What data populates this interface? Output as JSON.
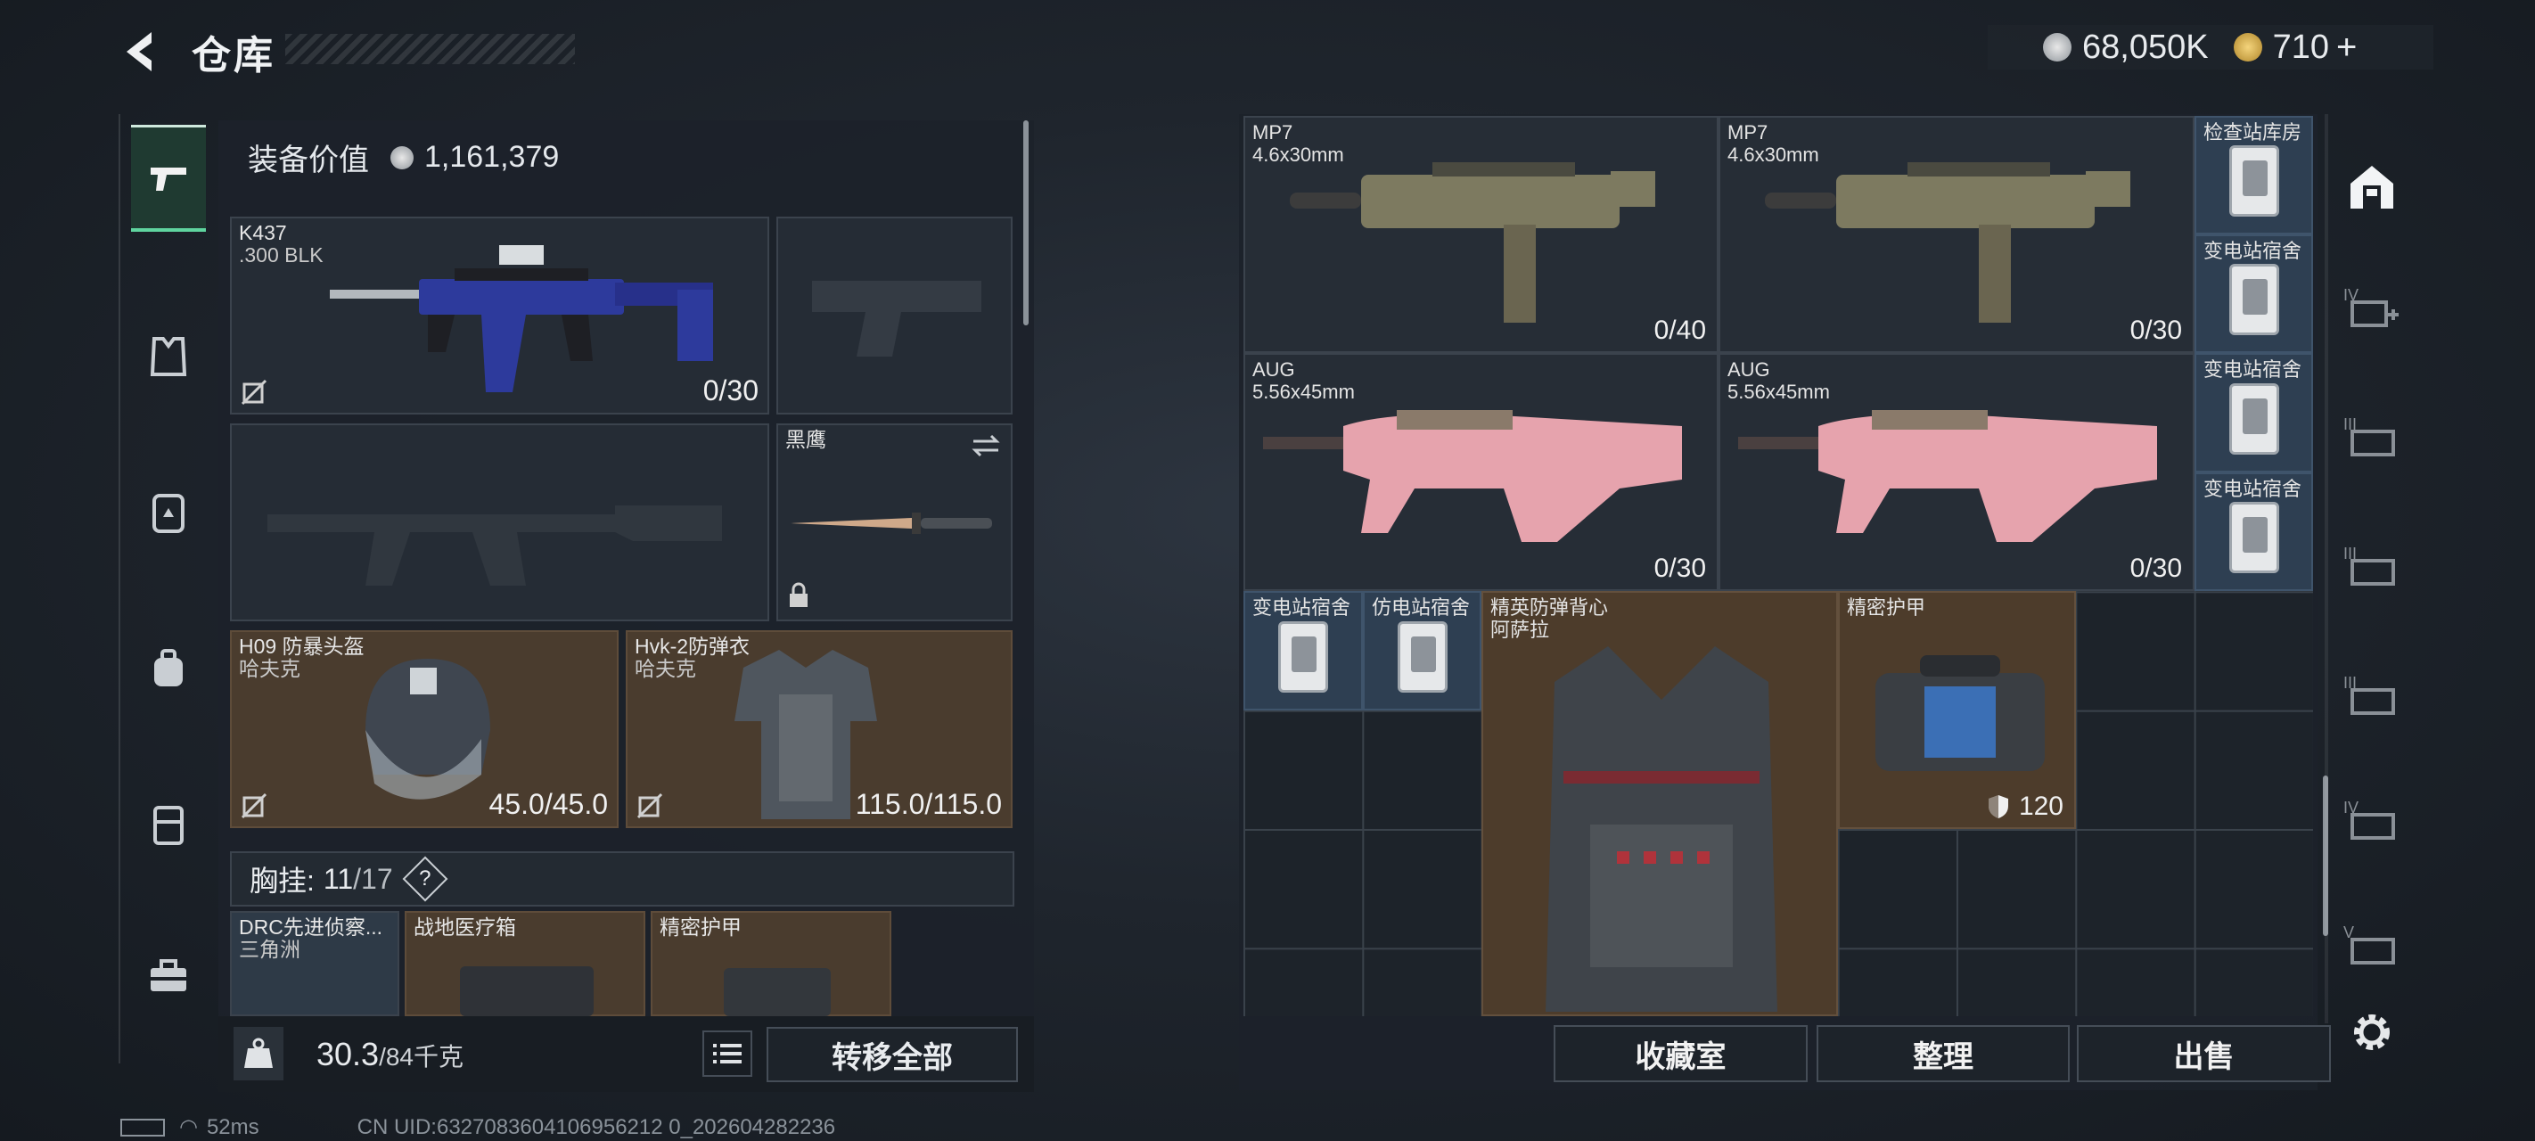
{
  "header": {
    "title": "仓库",
    "currency_silver": "68,050K",
    "currency_gold": "710"
  },
  "icons": {
    "back": "back-arrow-icon",
    "plus": "plus-icon"
  },
  "left_nav": [
    {
      "name": "nav-weapons",
      "icon": "pistol-icon",
      "active": true
    },
    {
      "name": "nav-vest",
      "icon": "vest-icon"
    },
    {
      "name": "nav-armor",
      "icon": "armor-icon"
    },
    {
      "name": "nav-backpack",
      "icon": "backpack-icon"
    },
    {
      "name": "nav-container",
      "icon": "container-icon"
    },
    {
      "name": "nav-toolbox",
      "icon": "toolbox-icon"
    }
  ],
  "loadout": {
    "value_label": "装备价值",
    "value": "1,161,379",
    "primary": {
      "name": "K437",
      "ammo": ".300 BLK",
      "count": "0/30"
    },
    "melee": {
      "name": "黑鹰"
    },
    "helmet": {
      "name": "H09 防暴头盔",
      "maker": "哈夫克",
      "durability": "45.0/45.0"
    },
    "body": {
      "name": "Hvk-2防弹衣",
      "maker": "哈夫克",
      "durability": "115.0/115.0"
    },
    "rig": {
      "label": "胸挂:",
      "used": "11",
      "total": "/17",
      "help": "?"
    },
    "rig_items": [
      {
        "name": "DRC先进侦察...",
        "maker": "三角洲"
      },
      {
        "name": "战地医疗箱"
      },
      {
        "name": "精密护甲"
      }
    ],
    "weight": "30.3",
    "weight_max": "/84千克",
    "transfer_all": "转移全部"
  },
  "stash": {
    "weapons": [
      {
        "name": "MP7",
        "ammo": "4.6x30mm",
        "count": "0/40"
      },
      {
        "name": "MP7",
        "ammo": "4.6x30mm",
        "count": "0/30"
      },
      {
        "name": "AUG",
        "ammo": "5.56x45mm",
        "count": "0/30"
      },
      {
        "name": "AUG",
        "ammo": "5.56x45mm",
        "count": "0/30"
      }
    ],
    "cards": [
      {
        "name": "检查站库房"
      },
      {
        "name": "变电站宿舍"
      },
      {
        "name": "变电站宿舍"
      },
      {
        "name": "变电站宿舍"
      },
      {
        "name": "变电站宿舍"
      },
      {
        "name": "仿电站宿舍"
      }
    ],
    "vest": {
      "name": "精英防弹背心",
      "maker": "阿萨拉"
    },
    "armor": {
      "name": "精密护甲",
      "value": "120"
    },
    "buttons": {
      "collect": "收藏室",
      "sort": "整理",
      "sell": "出售"
    }
  },
  "right_tabs": [
    "home-base-icon",
    "IV",
    "III",
    "III",
    "III",
    "IV",
    "V"
  ],
  "status_bar": {
    "ping": "52ms",
    "uid": "CN UID:6327083604106956212 0_202604282236"
  },
  "colors": {
    "accent_green": "#5fd49f",
    "slot_brown": "#4a3c2e",
    "slot_blue": "#2e3f52",
    "aug_pink": "#e6a3ad"
  }
}
